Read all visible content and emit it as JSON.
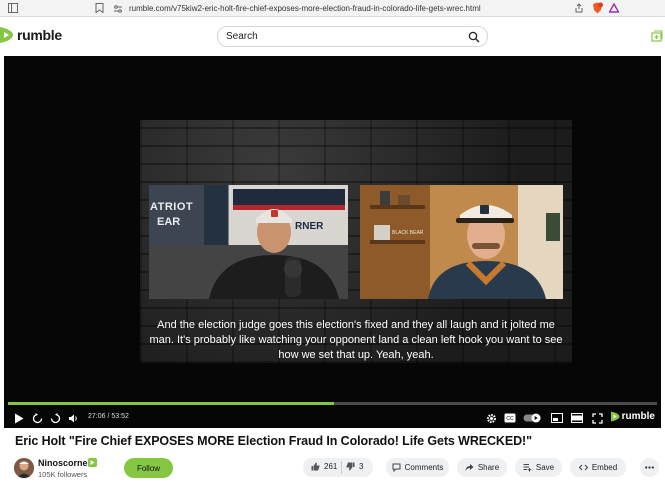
{
  "browser": {
    "url": "rumble.com/v75kiw2-eric-holt-fire-chief-exposes-more-election-fraud-in-colorado-life-gets-wrec.html"
  },
  "header": {
    "logo_text": "rumble",
    "search_placeholder": "Search"
  },
  "player": {
    "caption": "And the election judge goes this election's fixed and they all laugh and it jolted me man. It's probably like watching your opponent land a clean left hook you want to see how we set that up. Yeah, yeah.",
    "time": "27:06 / 53:52",
    "progress_fraction": 0.503,
    "brand": "rumble",
    "left_cam_sign_1": "ATRIOT",
    "left_cam_sign_2": "EAR",
    "left_cam_sign_3": "RNER",
    "right_cam_sign": "BLACK BEAR"
  },
  "video": {
    "title": "Eric Holt \"Fire Chief EXPOSES MORE Election Fraud In Colorado! Life Gets WRECKED!\""
  },
  "channel": {
    "name": "Ninoscorner",
    "followers": "105K followers",
    "follow_label": "Follow"
  },
  "actions": {
    "likes": "261",
    "dislikes": "3",
    "comments_label": "Comments",
    "share_label": "Share",
    "save_label": "Save",
    "embed_label": "Embed"
  },
  "colors": {
    "accent": "#85c742",
    "player_bg": "#060606",
    "pill_bg": "#eef0f2"
  }
}
